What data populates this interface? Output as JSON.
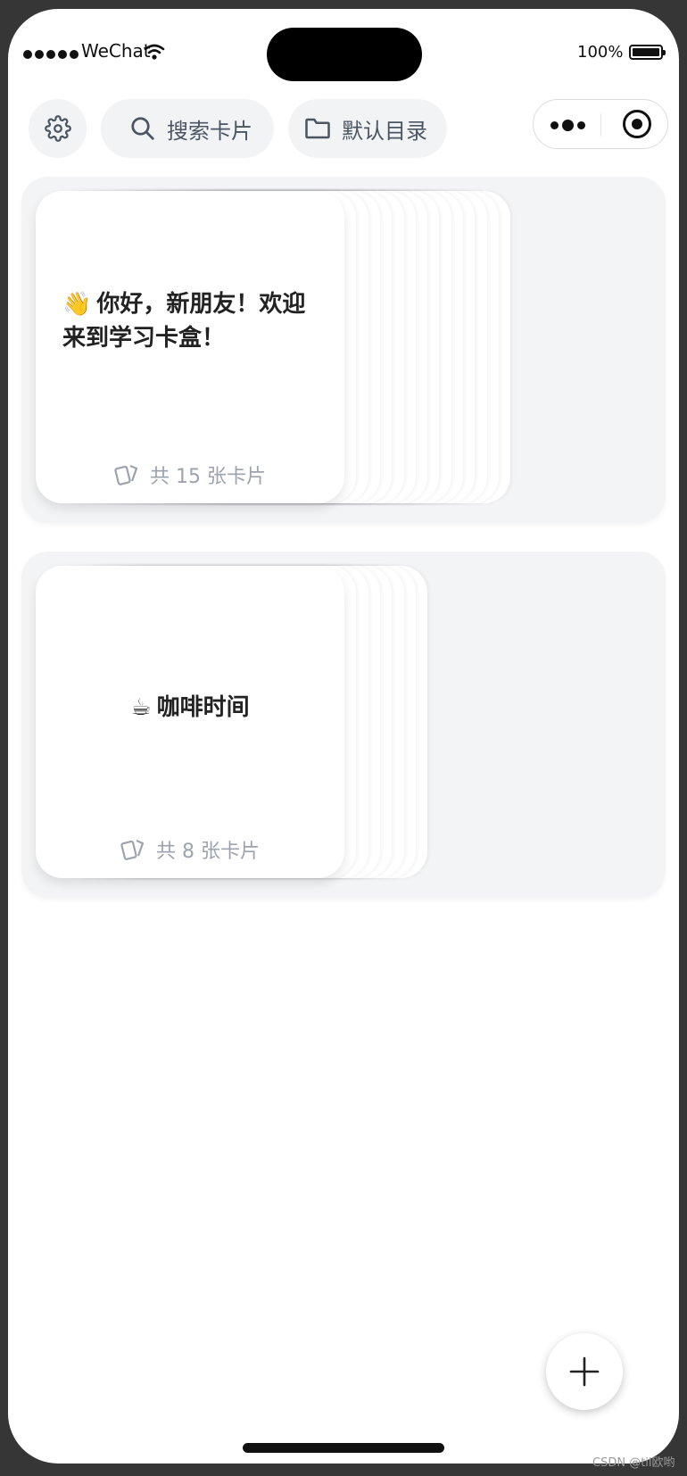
{
  "status_bar": {
    "carrier": "WeChat",
    "battery": "100%"
  },
  "toolbar": {
    "search_label": "搜索卡片",
    "folder_label": "默认目录"
  },
  "decks": [
    {
      "emoji": "👋",
      "title": "你好，新朋友！欢迎来到学习卡盒！",
      "count_label": "共 15 张卡片",
      "card_count": 15
    },
    {
      "emoji": "☕",
      "title": "咖啡时间",
      "count_label": "共 8 张卡片",
      "card_count": 8
    }
  ],
  "watermark": "CSDN @til欧哟",
  "icons": {
    "settings": "gear-icon",
    "search": "search-icon",
    "folder": "folder-icon",
    "more": "more-dots-icon",
    "close": "target-icon",
    "cards": "cards-icon",
    "add": "plus-icon"
  }
}
